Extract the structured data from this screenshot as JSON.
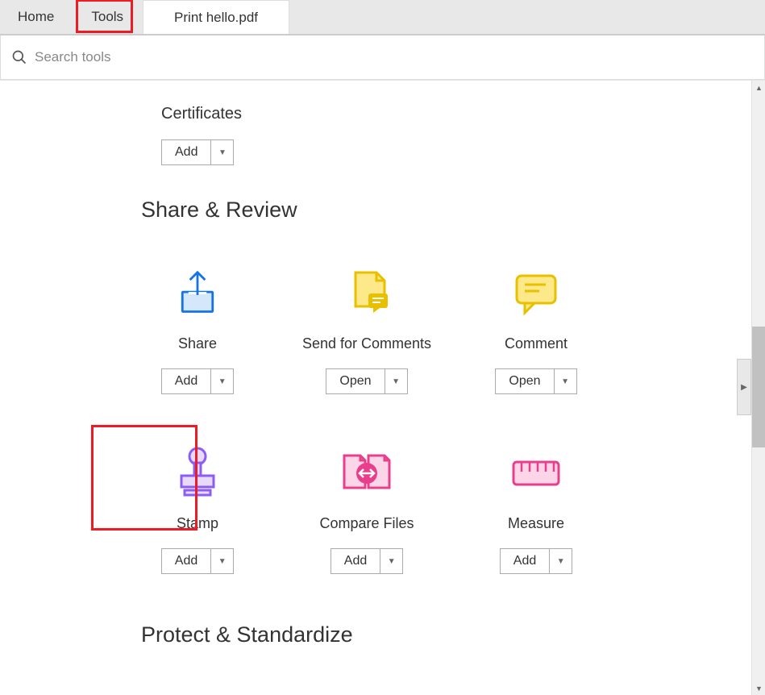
{
  "tabs": {
    "home": "Home",
    "tools": "Tools",
    "doc": "Print hello.pdf"
  },
  "search": {
    "placeholder": "Search tools"
  },
  "certificates": {
    "title": "Certificates",
    "action": "Add"
  },
  "sections": {
    "share_review": "Share & Review",
    "protect_standardize": "Protect & Standardize"
  },
  "tools": {
    "share": {
      "label": "Share",
      "action": "Add"
    },
    "send_comments": {
      "label": "Send for Comments",
      "action": "Open"
    },
    "comment": {
      "label": "Comment",
      "action": "Open"
    },
    "stamp": {
      "label": "Stamp",
      "action": "Add"
    },
    "compare": {
      "label": "Compare Files",
      "action": "Add"
    },
    "measure": {
      "label": "Measure",
      "action": "Add"
    }
  }
}
